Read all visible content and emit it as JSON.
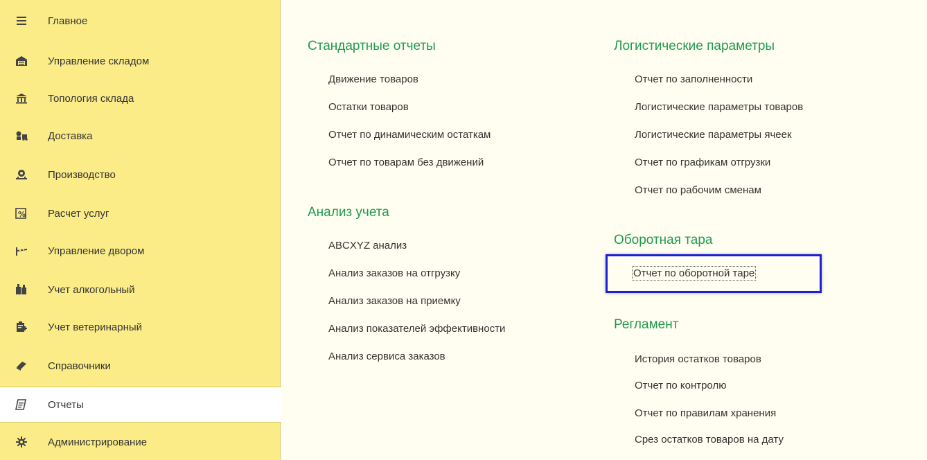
{
  "sidebar": {
    "items": [
      {
        "label": "Главное",
        "icon": "menu-icon"
      },
      {
        "label": "Управление складом",
        "icon": "warehouse-icon"
      },
      {
        "label": "Топология склада",
        "icon": "building-icon"
      },
      {
        "label": "Доставка",
        "icon": "delivery-icon"
      },
      {
        "label": "Производство",
        "icon": "production-icon"
      },
      {
        "label": "Расчет услуг",
        "icon": "percent-calc-icon"
      },
      {
        "label": "Управление двором",
        "icon": "barrier-icon"
      },
      {
        "label": "Учет алкогольный",
        "icon": "bottles-icon"
      },
      {
        "label": "Учет ветеринарный",
        "icon": "clipboard-plus-icon"
      },
      {
        "label": "Справочники",
        "icon": "book-icon"
      },
      {
        "label": "Отчеты",
        "icon": "report-icon"
      },
      {
        "label": "Администрирование",
        "icon": "gear-icon"
      }
    ],
    "active_index": 10
  },
  "sections": {
    "standard": {
      "title": "Стандартные отчеты",
      "links": [
        "Движение товаров",
        "Остатки товаров",
        "Отчет по динамическим остаткам",
        "Отчет по товарам без движений"
      ]
    },
    "analysis": {
      "title": "Анализ учета",
      "links": [
        "ABCXYZ анализ",
        "Анализ заказов на отгрузку",
        "Анализ заказов на приемку",
        "Анализ показателей эффективности",
        "Анализ сервиса заказов"
      ]
    },
    "logistics": {
      "title": "Логистические параметры",
      "links": [
        "Отчет по заполненности",
        "Логистические параметры товаров",
        "Логистические параметры ячеек",
        "Отчет по графикам отгрузки",
        "Отчет по рабочим сменам"
      ]
    },
    "returnable": {
      "title": "Оборотная тара",
      "links": [
        "Отчет по оборотной таре"
      ]
    },
    "reglament": {
      "title": "Регламент",
      "links": [
        "История остатков товаров",
        "Отчет по контролю",
        "Отчет по правилам хранения",
        "Срез остатков товаров на дату"
      ]
    }
  },
  "colors": {
    "sidebar_bg": "#fbec88",
    "section_title": "#1f9a50",
    "highlight": "#1a22d4"
  }
}
